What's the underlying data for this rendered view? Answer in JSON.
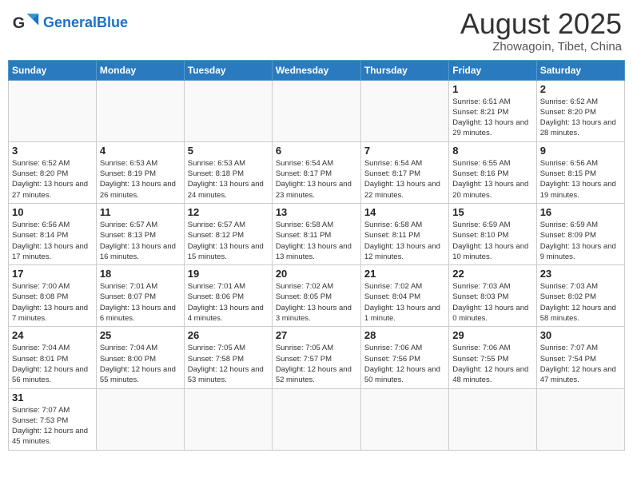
{
  "header": {
    "logo_general": "General",
    "logo_blue": "Blue",
    "month_title": "August 2025",
    "location": "Zhowagoin, Tibet, China"
  },
  "weekdays": [
    "Sunday",
    "Monday",
    "Tuesday",
    "Wednesday",
    "Thursday",
    "Friday",
    "Saturday"
  ],
  "weeks": [
    [
      {
        "day": "",
        "info": ""
      },
      {
        "day": "",
        "info": ""
      },
      {
        "day": "",
        "info": ""
      },
      {
        "day": "",
        "info": ""
      },
      {
        "day": "",
        "info": ""
      },
      {
        "day": "1",
        "info": "Sunrise: 6:51 AM\nSunset: 8:21 PM\nDaylight: 13 hours and 29 minutes."
      },
      {
        "day": "2",
        "info": "Sunrise: 6:52 AM\nSunset: 8:20 PM\nDaylight: 13 hours and 28 minutes."
      }
    ],
    [
      {
        "day": "3",
        "info": "Sunrise: 6:52 AM\nSunset: 8:20 PM\nDaylight: 13 hours and 27 minutes."
      },
      {
        "day": "4",
        "info": "Sunrise: 6:53 AM\nSunset: 8:19 PM\nDaylight: 13 hours and 26 minutes."
      },
      {
        "day": "5",
        "info": "Sunrise: 6:53 AM\nSunset: 8:18 PM\nDaylight: 13 hours and 24 minutes."
      },
      {
        "day": "6",
        "info": "Sunrise: 6:54 AM\nSunset: 8:17 PM\nDaylight: 13 hours and 23 minutes."
      },
      {
        "day": "7",
        "info": "Sunrise: 6:54 AM\nSunset: 8:17 PM\nDaylight: 13 hours and 22 minutes."
      },
      {
        "day": "8",
        "info": "Sunrise: 6:55 AM\nSunset: 8:16 PM\nDaylight: 13 hours and 20 minutes."
      },
      {
        "day": "9",
        "info": "Sunrise: 6:56 AM\nSunset: 8:15 PM\nDaylight: 13 hours and 19 minutes."
      }
    ],
    [
      {
        "day": "10",
        "info": "Sunrise: 6:56 AM\nSunset: 8:14 PM\nDaylight: 13 hours and 17 minutes."
      },
      {
        "day": "11",
        "info": "Sunrise: 6:57 AM\nSunset: 8:13 PM\nDaylight: 13 hours and 16 minutes."
      },
      {
        "day": "12",
        "info": "Sunrise: 6:57 AM\nSunset: 8:12 PM\nDaylight: 13 hours and 15 minutes."
      },
      {
        "day": "13",
        "info": "Sunrise: 6:58 AM\nSunset: 8:11 PM\nDaylight: 13 hours and 13 minutes."
      },
      {
        "day": "14",
        "info": "Sunrise: 6:58 AM\nSunset: 8:11 PM\nDaylight: 13 hours and 12 minutes."
      },
      {
        "day": "15",
        "info": "Sunrise: 6:59 AM\nSunset: 8:10 PM\nDaylight: 13 hours and 10 minutes."
      },
      {
        "day": "16",
        "info": "Sunrise: 6:59 AM\nSunset: 8:09 PM\nDaylight: 13 hours and 9 minutes."
      }
    ],
    [
      {
        "day": "17",
        "info": "Sunrise: 7:00 AM\nSunset: 8:08 PM\nDaylight: 13 hours and 7 minutes."
      },
      {
        "day": "18",
        "info": "Sunrise: 7:01 AM\nSunset: 8:07 PM\nDaylight: 13 hours and 6 minutes."
      },
      {
        "day": "19",
        "info": "Sunrise: 7:01 AM\nSunset: 8:06 PM\nDaylight: 13 hours and 4 minutes."
      },
      {
        "day": "20",
        "info": "Sunrise: 7:02 AM\nSunset: 8:05 PM\nDaylight: 13 hours and 3 minutes."
      },
      {
        "day": "21",
        "info": "Sunrise: 7:02 AM\nSunset: 8:04 PM\nDaylight: 13 hours and 1 minute."
      },
      {
        "day": "22",
        "info": "Sunrise: 7:03 AM\nSunset: 8:03 PM\nDaylight: 13 hours and 0 minutes."
      },
      {
        "day": "23",
        "info": "Sunrise: 7:03 AM\nSunset: 8:02 PM\nDaylight: 12 hours and 58 minutes."
      }
    ],
    [
      {
        "day": "24",
        "info": "Sunrise: 7:04 AM\nSunset: 8:01 PM\nDaylight: 12 hours and 56 minutes."
      },
      {
        "day": "25",
        "info": "Sunrise: 7:04 AM\nSunset: 8:00 PM\nDaylight: 12 hours and 55 minutes."
      },
      {
        "day": "26",
        "info": "Sunrise: 7:05 AM\nSunset: 7:58 PM\nDaylight: 12 hours and 53 minutes."
      },
      {
        "day": "27",
        "info": "Sunrise: 7:05 AM\nSunset: 7:57 PM\nDaylight: 12 hours and 52 minutes."
      },
      {
        "day": "28",
        "info": "Sunrise: 7:06 AM\nSunset: 7:56 PM\nDaylight: 12 hours and 50 minutes."
      },
      {
        "day": "29",
        "info": "Sunrise: 7:06 AM\nSunset: 7:55 PM\nDaylight: 12 hours and 48 minutes."
      },
      {
        "day": "30",
        "info": "Sunrise: 7:07 AM\nSunset: 7:54 PM\nDaylight: 12 hours and 47 minutes."
      }
    ],
    [
      {
        "day": "31",
        "info": "Sunrise: 7:07 AM\nSunset: 7:53 PM\nDaylight: 12 hours and 45 minutes."
      },
      {
        "day": "",
        "info": ""
      },
      {
        "day": "",
        "info": ""
      },
      {
        "day": "",
        "info": ""
      },
      {
        "day": "",
        "info": ""
      },
      {
        "day": "",
        "info": ""
      },
      {
        "day": "",
        "info": ""
      }
    ]
  ]
}
